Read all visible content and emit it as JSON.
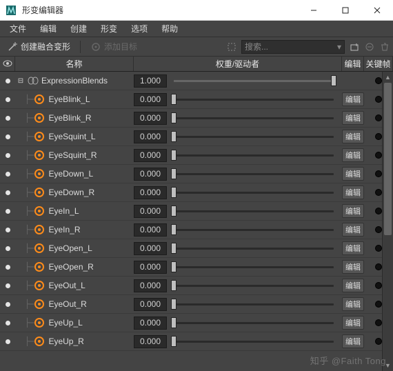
{
  "window": {
    "title": "形变编辑器"
  },
  "menu": {
    "file": "文件",
    "edit": "编辑",
    "create": "创建",
    "shape": "形变",
    "options": "选项",
    "help": "帮助"
  },
  "toolbar": {
    "create_fused": "创建融合变形",
    "add_target": "添加目标",
    "search_placeholder": "搜索..."
  },
  "columns": {
    "visibility": "",
    "name": "名称",
    "weight": "权重/驱动者",
    "edit": "编辑",
    "key": "关键帧"
  },
  "labels": {
    "edit_short": "编辑"
  },
  "group": {
    "name": "ExpressionBlends",
    "weight": "1.000",
    "slider": 1.0
  },
  "rows": [
    {
      "name": "EyeBlink_L",
      "weight": "0.000",
      "slider": 0.0,
      "edit": true
    },
    {
      "name": "EyeBlink_R",
      "weight": "0.000",
      "slider": 0.0,
      "edit": true
    },
    {
      "name": "EyeSquint_L",
      "weight": "0.000",
      "slider": 0.0,
      "edit": true
    },
    {
      "name": "EyeSquint_R",
      "weight": "0.000",
      "slider": 0.0,
      "edit": true
    },
    {
      "name": "EyeDown_L",
      "weight": "0.000",
      "slider": 0.0,
      "edit": true
    },
    {
      "name": "EyeDown_R",
      "weight": "0.000",
      "slider": 0.0,
      "edit": true
    },
    {
      "name": "EyeIn_L",
      "weight": "0.000",
      "slider": 0.0,
      "edit": true
    },
    {
      "name": "EyeIn_R",
      "weight": "0.000",
      "slider": 0.0,
      "edit": true
    },
    {
      "name": "EyeOpen_L",
      "weight": "0.000",
      "slider": 0.0,
      "edit": true
    },
    {
      "name": "EyeOpen_R",
      "weight": "0.000",
      "slider": 0.0,
      "edit": true
    },
    {
      "name": "EyeOut_L",
      "weight": "0.000",
      "slider": 0.0,
      "edit": true
    },
    {
      "name": "EyeOut_R",
      "weight": "0.000",
      "slider": 0.0,
      "edit": true
    },
    {
      "name": "EyeUp_L",
      "weight": "0.000",
      "slider": 0.0,
      "edit": true
    },
    {
      "name": "EyeUp_R",
      "weight": "0.000",
      "slider": 0.0,
      "edit": true
    }
  ],
  "watermark": "知乎 @Faith Tong"
}
